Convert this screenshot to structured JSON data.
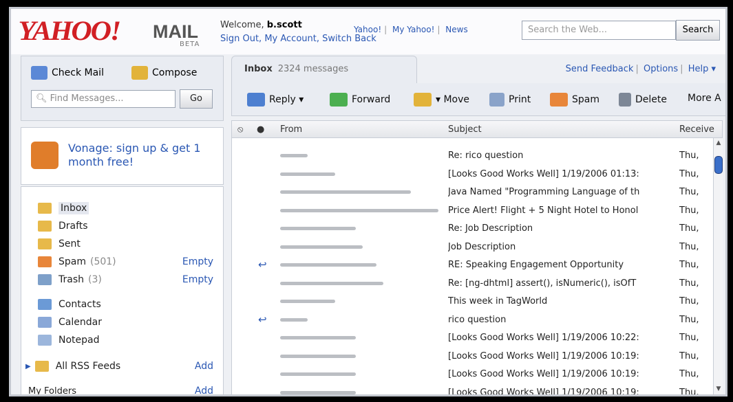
{
  "header": {
    "logo": "YAHOO!",
    "mail": "MAIL",
    "beta": "BETA",
    "welcome_prefix": "Welcome,",
    "user": "b.scott",
    "account_links": "Sign Out, My Account, Switch Back",
    "yahoo_links": [
      "Yahoo!",
      "My Yahoo!",
      "News"
    ],
    "search_placeholder": "Search the Web...",
    "search_button": "Search"
  },
  "left": {
    "check_mail": "Check Mail",
    "compose": "Compose",
    "find_placeholder": "Find Messages...",
    "go": "Go",
    "ad_text": "Vonage: sign up & get 1 month free!",
    "folders": [
      {
        "label": "Inbox",
        "count": "",
        "action": ""
      },
      {
        "label": "Drafts",
        "count": "",
        "action": ""
      },
      {
        "label": "Sent",
        "count": "",
        "action": ""
      },
      {
        "label": "Spam",
        "count": "(501)",
        "action": "Empty"
      },
      {
        "label": "Trash",
        "count": "(3)",
        "action": "Empty"
      }
    ],
    "apps": [
      "Contacts",
      "Calendar",
      "Notepad"
    ],
    "rss": {
      "label": "All RSS Feeds",
      "action": "Add"
    },
    "my_folders": {
      "label": "My Folders",
      "action": "Add"
    }
  },
  "main": {
    "tab_title": "Inbox",
    "tab_count": "2324 messages",
    "feedback": "Send Feedback",
    "options": "Options",
    "help": "Help ▾",
    "toolbar": [
      "Reply ▾",
      "Forward",
      "▾ Move",
      "Print",
      "Spam",
      "Delete",
      "More A"
    ],
    "columns": [
      "From",
      "Subject",
      "Receive"
    ],
    "messages": [
      {
        "subject": "Re: rico question",
        "date": "Thu,",
        "replied": false
      },
      {
        "subject": "[Looks Good Works Well] 1/19/2006 01:13:",
        "date": "Thu,",
        "replied": false
      },
      {
        "subject": "Java Named \"Programming Language of th",
        "date": "Thu,",
        "replied": false
      },
      {
        "subject": "Price Alert! Flight + 5 Night Hotel to Honol",
        "date": "Thu,",
        "replied": false
      },
      {
        "subject": "Re: Job Description",
        "date": "Thu,",
        "replied": false
      },
      {
        "subject": "Job Description",
        "date": "Thu,",
        "replied": false
      },
      {
        "subject": "RE: Speaking Engagement Opportunity",
        "date": "Thu,",
        "replied": true
      },
      {
        "subject": "Re: [ng-dhtml] assert(), isNumeric(), isOfT",
        "date": "Thu,",
        "replied": false
      },
      {
        "subject": "This week in TagWorld",
        "date": "Thu,",
        "replied": false
      },
      {
        "subject": "rico question",
        "date": "Thu,",
        "replied": true
      },
      {
        "subject": "[Looks Good Works Well] 1/19/2006 10:22:",
        "date": "Thu,",
        "replied": false
      },
      {
        "subject": "[Looks Good Works Well] 1/19/2006 10:19:",
        "date": "Thu,",
        "replied": false
      },
      {
        "subject": "[Looks Good Works Well] 1/19/2006 10:19:",
        "date": "Thu,",
        "replied": false
      },
      {
        "subject": "[Looks Good Works Well] 1/19/2006 10:19:",
        "date": "Thu,",
        "replied": false
      }
    ]
  }
}
